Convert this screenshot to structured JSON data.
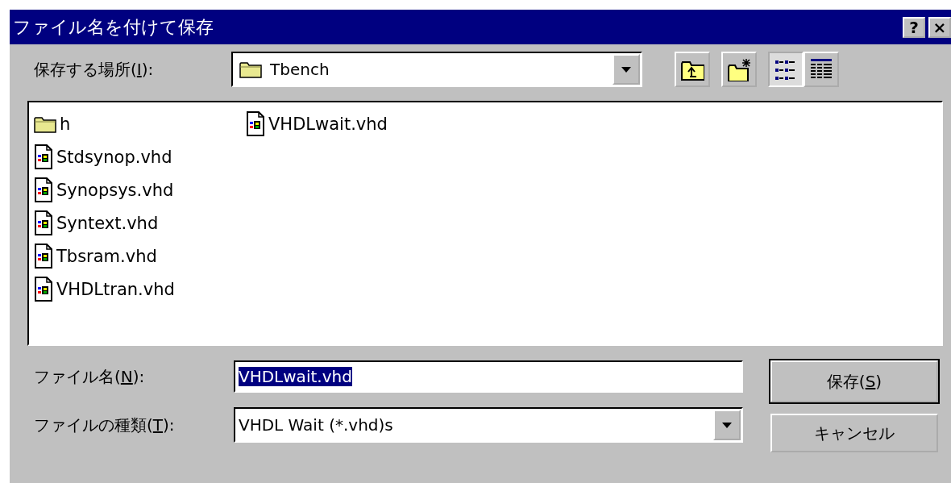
{
  "window": {
    "title": "ファイル名を付けて保存",
    "help_button": "?",
    "close_button": "×"
  },
  "location": {
    "label": {
      "before": "保存する場所(",
      "key": "I",
      "after": "):"
    },
    "value": "Tbench"
  },
  "toolbar": [
    {
      "kind": "up"
    },
    {
      "kind": "new_folder"
    },
    {
      "kind": "list",
      "selected": true
    },
    {
      "kind": "details",
      "selected": false
    }
  ],
  "files": [
    {
      "name": "h",
      "kind": "folder"
    },
    {
      "name": "Stdsynop.vhd",
      "kind": "file"
    },
    {
      "name": "Synopsys.vhd",
      "kind": "file"
    },
    {
      "name": "Syntext.vhd",
      "kind": "file"
    },
    {
      "name": "Tbsram.vhd",
      "kind": "file"
    },
    {
      "name": "VHDLtran.vhd",
      "kind": "file"
    },
    {
      "name": "VHDLwait.vhd",
      "kind": "file"
    }
  ],
  "file_name": {
    "label": {
      "before": "ファイル名(",
      "key": "N",
      "after": "):"
    },
    "value": "VHDLwait.vhd",
    "selected": true
  },
  "file_type": {
    "label": {
      "before": "ファイルの種類(",
      "key": "T",
      "after": "):"
    },
    "value": "VHDL Wait (*.vhd)s"
  },
  "buttons": [
    {
      "label": {
        "before": "保存(",
        "key": "S",
        "after": ")"
      },
      "default": true
    },
    {
      "label": {
        "before": "キャンセル"
      },
      "default": false
    }
  ]
}
